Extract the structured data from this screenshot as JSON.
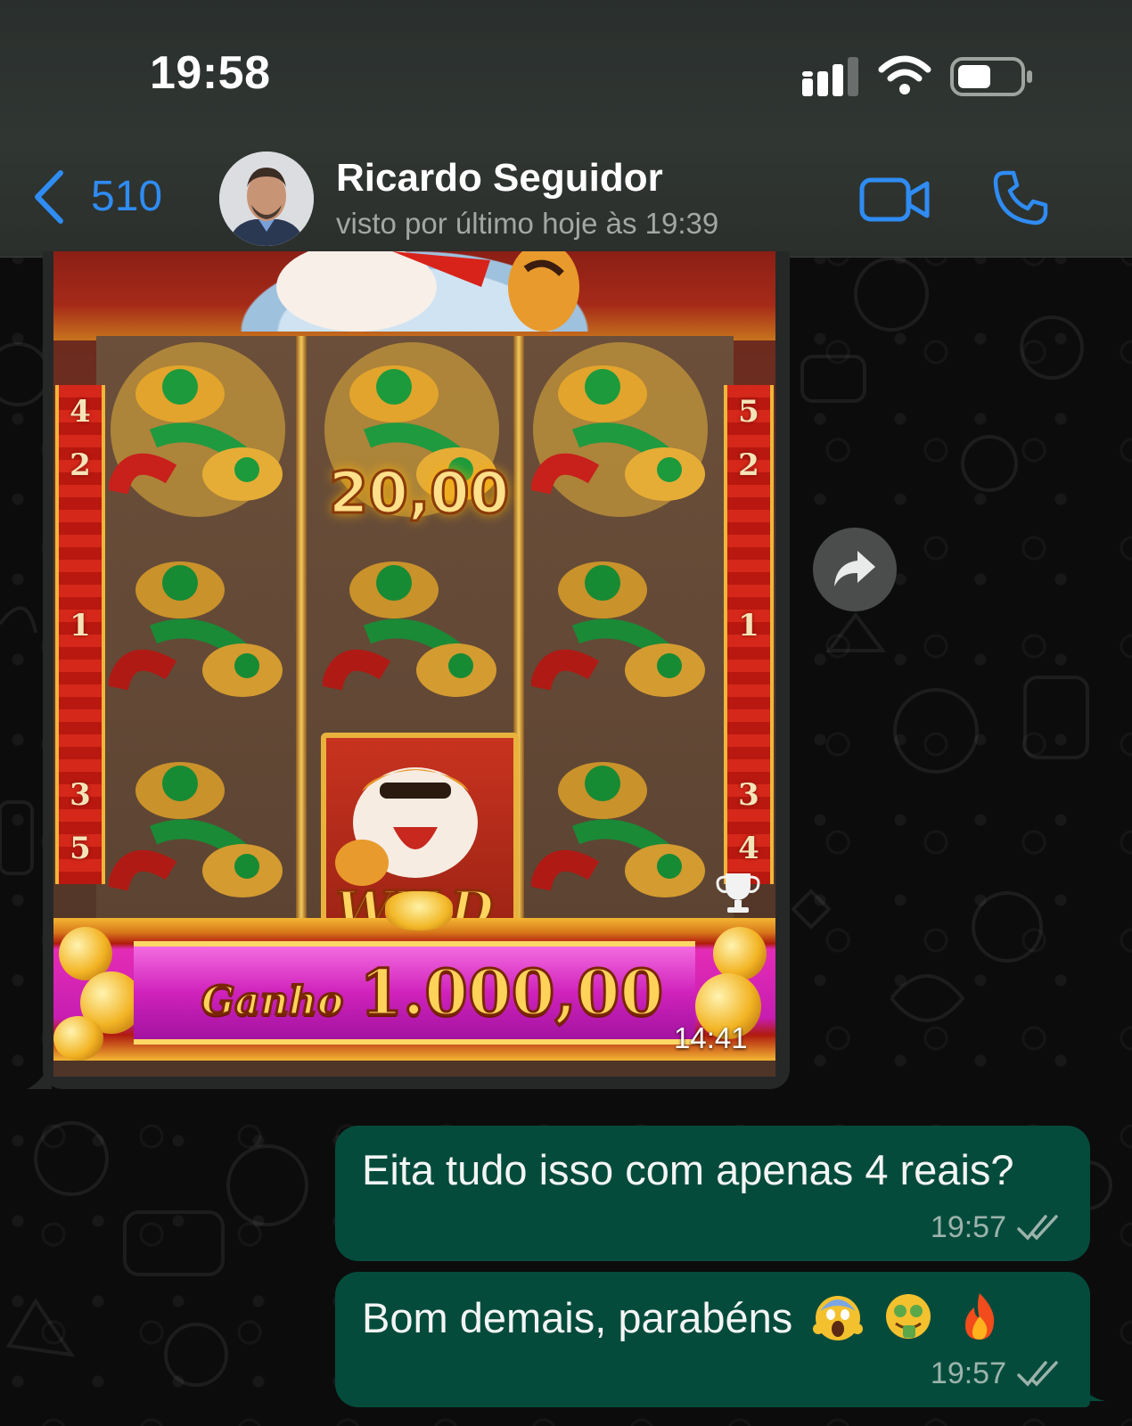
{
  "status_bar": {
    "time": "19:58"
  },
  "header": {
    "back_count": "510",
    "contact_name": "Ricardo Seguidor",
    "contact_status": "visto por último hoje às 19:39"
  },
  "messages": {
    "media": {
      "game": {
        "bet_value": "20,00",
        "win_label": "Ganho",
        "win_amount": "1.000,00",
        "wild_label": "WILD",
        "pillar_left": [
          "4",
          "2",
          "1",
          "3",
          "5"
        ],
        "pillar_right": [
          "5",
          "2",
          "1",
          "3",
          "4"
        ]
      },
      "time": "14:41"
    },
    "outgoing": [
      {
        "text": "Eita tudo isso com apenas 4 reais?",
        "time": "19:57"
      },
      {
        "text": "Bom demais, parabéns",
        "emojis": [
          "face-screaming",
          "money-mouth-face",
          "fire"
        ],
        "time": "19:57"
      }
    ]
  },
  "colors": {
    "accent_blue": "#2f8cf3",
    "outgoing_bubble": "#054b3c",
    "read_ticks": "#9bb3ab"
  },
  "icons": [
    "back-chevron-icon",
    "video-call-icon",
    "phone-icon",
    "forward-icon",
    "double-check-icon",
    "signal-icon",
    "wifi-icon",
    "battery-icon",
    "trophy-icon"
  ]
}
